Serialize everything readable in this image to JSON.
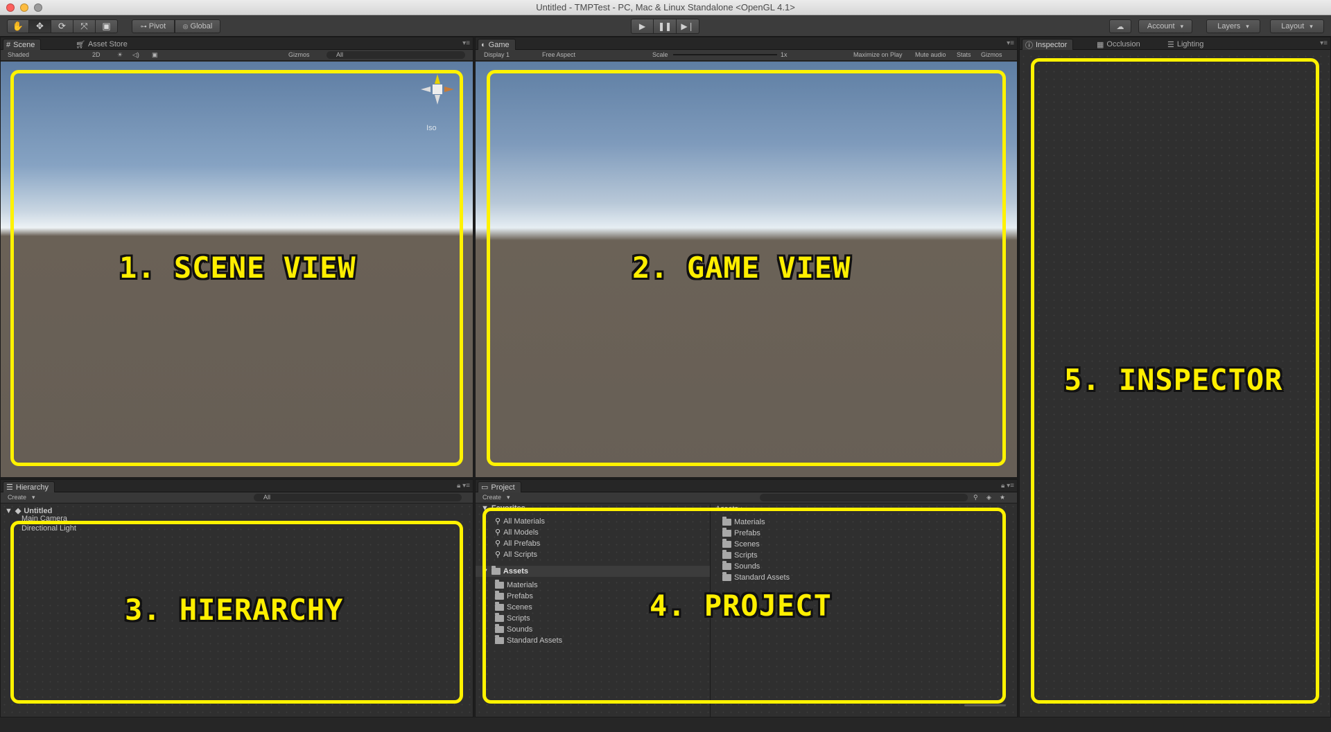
{
  "window": {
    "title": "Untitled - TMPTest - PC, Mac & Linux Standalone <OpenGL 4.1>"
  },
  "toolbar": {
    "tools": [
      "hand-tool",
      "move-tool",
      "rotate-tool",
      "scale-tool",
      "rect-tool"
    ],
    "pivot_label": "Pivot",
    "global_label": "Global",
    "account_label": "Account",
    "layers_label": "Layers",
    "layout_label": "Layout"
  },
  "scene": {
    "tab_label": "Scene",
    "asset_store_label": "Asset Store",
    "shading": "Shaded",
    "mode_2d": "2D",
    "gizmos_label": "Gizmos",
    "search_placeholder": "All",
    "iso_label": "Iso"
  },
  "game": {
    "tab_label": "Game",
    "display": "Display 1",
    "aspect": "Free Aspect",
    "scale_label": "Scale",
    "scale_value": "1x",
    "maximize_label": "Maximize on Play",
    "mute_label": "Mute audio",
    "stats_label": "Stats",
    "gizmos_label": "Gizmos"
  },
  "inspector": {
    "tab_label": "Inspector",
    "occlusion_label": "Occlusion",
    "lighting_label": "Lighting"
  },
  "hierarchy": {
    "tab_label": "Hierarchy",
    "create_label": "Create",
    "search_placeholder": "All",
    "scene_name": "Untitled",
    "items": [
      "Main Camera",
      "Directional Light"
    ]
  },
  "project": {
    "tab_label": "Project",
    "create_label": "Create",
    "favorites_label": "Favorites",
    "favorites": [
      "All Materials",
      "All Models",
      "All Prefabs",
      "All Scripts"
    ],
    "assets_label": "Assets",
    "asset_folders": [
      "Materials",
      "Prefabs",
      "Scenes",
      "Scripts",
      "Sounds",
      "Standard Assets"
    ],
    "assets_header": "Assets",
    "right_folders": [
      "Materials",
      "Prefabs",
      "Scenes",
      "Scripts",
      "Sounds",
      "Standard Assets"
    ]
  },
  "overlays": {
    "scene": "1. SCENE VIEW",
    "game": "2. GAME VIEW",
    "hierarchy": "3. HIERARCHY",
    "project": "4. PROJECT",
    "inspector": "5. INSPECTOR"
  },
  "colors": {
    "highlight": "#fff200",
    "panel_bg": "#2f2f2f"
  }
}
